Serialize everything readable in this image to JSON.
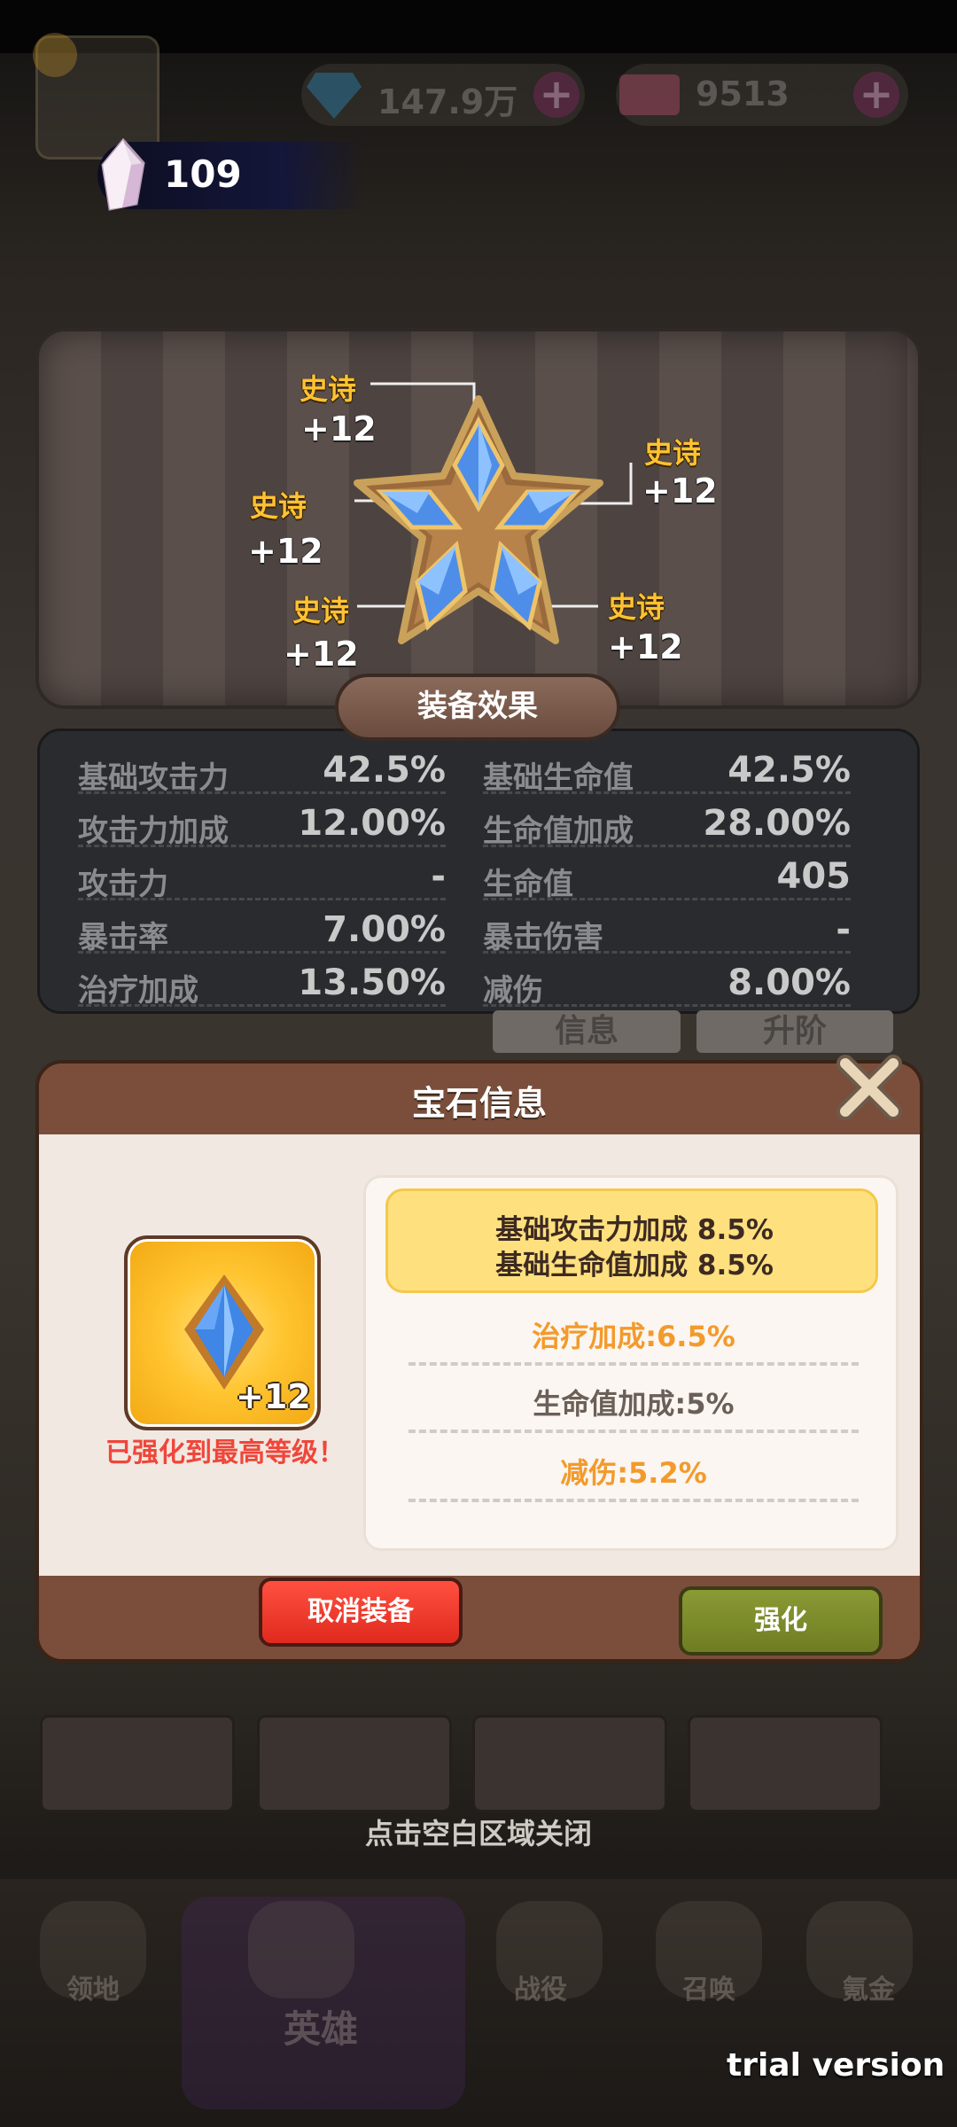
{
  "resources": {
    "diamonds": "147.9万",
    "tickets": "9513",
    "crystals": "109"
  },
  "gem_socket": {
    "slots": [
      {
        "tier": "史诗",
        "level": "+12"
      },
      {
        "tier": "史诗",
        "level": "+12"
      },
      {
        "tier": "史诗",
        "level": "+12"
      },
      {
        "tier": "史诗",
        "level": "+12"
      },
      {
        "tier": "史诗",
        "level": "+12"
      }
    ]
  },
  "equip_effects": {
    "title": "装备效果",
    "rows": [
      {
        "left_label": "基础攻击力",
        "left_value": "42.5%",
        "right_label": "基础生命值",
        "right_value": "42.5%"
      },
      {
        "left_label": "攻击力加成",
        "left_value": "12.00%",
        "right_label": "生命值加成",
        "right_value": "28.00%"
      },
      {
        "left_label": "攻击力",
        "left_value": "-",
        "right_label": "生命值",
        "right_value": "405"
      },
      {
        "left_label": "暴击率",
        "left_value": "7.00%",
        "right_label": "暴击伤害",
        "right_value": "-"
      },
      {
        "left_label": "治疗加成",
        "left_value": "13.50%",
        "right_label": "减伤",
        "right_value": "8.00%"
      }
    ]
  },
  "background_tabs": {
    "info": "信息",
    "advance": "升阶"
  },
  "gem_dialog": {
    "title": "宝石信息",
    "gem_level": "+12",
    "max_level_text": "已强化到最高等级！",
    "main_stats": [
      "基础攻击力加成 8.5%",
      "基础生命值加成 8.5%"
    ],
    "sub_stats": [
      {
        "text": "治疗加成:6.5%",
        "color": "#f39a2c"
      },
      {
        "text": "生命值加成:5%",
        "color": "#6b5f58"
      },
      {
        "text": "减伤:5.2%",
        "color": "#f39a2c"
      }
    ],
    "unequip_label": "取消装备",
    "upgrade_label": "强化"
  },
  "close_hint": "点击空白区域关闭",
  "nav": {
    "items": [
      "领地",
      "英雄",
      "战役",
      "召唤",
      "氪金"
    ]
  },
  "watermark": "trial version",
  "colors": {
    "tier_gold": "#ffc233",
    "danger_red": "#e02a1e",
    "upgrade_green": "#7d8c2a",
    "highlight_yellow": "#ffe07e"
  }
}
